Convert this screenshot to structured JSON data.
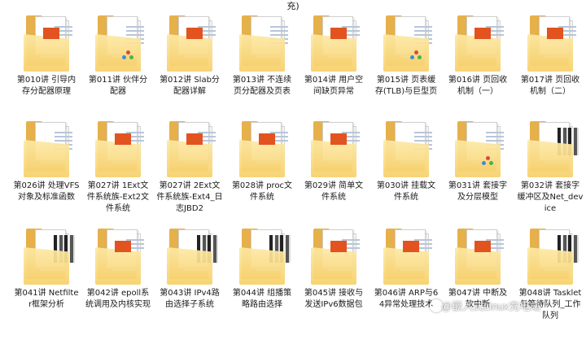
{
  "top_text": "充)",
  "items": [
    {
      "label": "第010讲 引导内存分配器原理",
      "icon": "pdf-folder-icon"
    },
    {
      "label": "第011讲 伙伴分配器",
      "icon": "diagram-folder-icon"
    },
    {
      "label": "第012讲 Slab分配器详解",
      "icon": "pdf-folder-icon"
    },
    {
      "label": "第013讲 不连续页分配器及页表",
      "icon": "document-folder-icon"
    },
    {
      "label": "第014讲 用户空间缺页异常",
      "icon": "pdf-folder-icon"
    },
    {
      "label": "第015讲 页表缓存(TLB)与巨型页",
      "icon": "diagram-folder-icon"
    },
    {
      "label": "第016讲 页回收机制（一）",
      "icon": "pdf-folder-icon"
    },
    {
      "label": "第017讲 页回收机制（二）",
      "icon": "pdf-folder-icon"
    },
    {
      "label": "第026讲 处理VFS对象及标准函数",
      "icon": "document-folder-icon"
    },
    {
      "label": "第027讲 1Ext文件系统族-Ext2文件系统",
      "icon": "pdf-folder-icon"
    },
    {
      "label": "第027讲 2Ext文件系统族-Ext4_日志JBD2",
      "icon": "pdf-folder-icon"
    },
    {
      "label": "第028讲 proc文件系统",
      "icon": "pdf-folder-icon"
    },
    {
      "label": "第029讲 简单文件系统",
      "icon": "pdf-folder-icon"
    },
    {
      "label": "第030讲 挂载文件系统",
      "icon": "document-folder-icon"
    },
    {
      "label": "第031讲 套接字及分层模型",
      "icon": "diagram-folder-icon"
    },
    {
      "label": "第032讲 套接字缓冲区及Net_device",
      "icon": "dark-document-folder-icon"
    },
    {
      "label": "第041讲 Netfilter框架分析",
      "icon": "dark-document-folder-icon"
    },
    {
      "label": "第042讲 epoll系统调用及内核实现",
      "icon": "pdf-folder-icon"
    },
    {
      "label": "第043讲 IPv4路由选择子系统",
      "icon": "dark-document-folder-icon"
    },
    {
      "label": "第044讲 组播策略路由选择",
      "icon": "dark-document-folder-icon"
    },
    {
      "label": "第045讲 接收与发送IPv6数据包",
      "icon": "pdf-folder-icon"
    },
    {
      "label": "第046讲 ARP与64异常处理技术",
      "icon": "pdf-folder-icon"
    },
    {
      "label": "第047讲 中断及软中断",
      "icon": "pdf-folder-icon"
    },
    {
      "label": "第048讲 Tasklet与等待队列_工作队列",
      "icon": "dark-document-folder-icon"
    }
  ],
  "watermark": "@嵌入式Linux充电站",
  "colors": {
    "folder": "#f7d06a",
    "pdf": "#e2531f",
    "background": "#ffffff"
  }
}
